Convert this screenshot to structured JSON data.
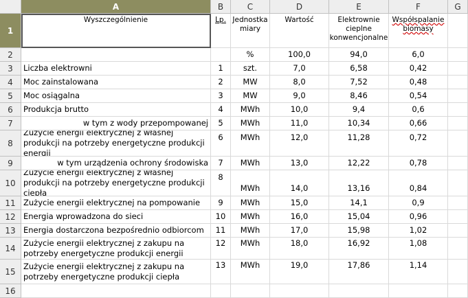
{
  "columns": [
    "A",
    "B",
    "C",
    "D",
    "E",
    "F",
    "G"
  ],
  "header": {
    "row_num": "1",
    "a": "Wyszczególnienie",
    "b": "Lp.",
    "c": "Jednostka miary",
    "d": "Wartość",
    "e": "Elektrownie cieplne konwencjonalne",
    "f": "Współspalanie biomasy"
  },
  "row2": {
    "row_num": "2",
    "c": "%",
    "d": "100,0",
    "e": "94,0",
    "f": "6,0"
  },
  "rows": [
    {
      "row_num": "3",
      "a": "Liczba elektrowni",
      "b": "1",
      "c": "szt.",
      "d": "7,0",
      "e": "6,58",
      "f": "0,42"
    },
    {
      "row_num": "4",
      "a": "Moc zainstalowana",
      "b": "2",
      "c": "MW",
      "d": "8,0",
      "e": "7,52",
      "f": "0,48"
    },
    {
      "row_num": "5",
      "a": "Moc osiągalna",
      "b": "3",
      "c": "MW",
      "d": "9,0",
      "e": "8,46",
      "f": "0,54"
    },
    {
      "row_num": "6",
      "a": "Produkcja brutto",
      "b": "4",
      "c": "MWh",
      "d": "10,0",
      "e": "9,4",
      "f": "0,6"
    },
    {
      "row_num": "7",
      "a": "w tym z wody przepompowanej",
      "b": "5",
      "c": "MWh",
      "d": "11,0",
      "e": "10,34",
      "f": "0,66"
    },
    {
      "row_num": "8",
      "a": "Zużycie energii elektrycznej z własnej produkcji na potrzeby energetyczne produkcji energii",
      "b": "6",
      "c": "MWh",
      "d": "12,0",
      "e": "11,28",
      "f": "0,72"
    },
    {
      "row_num": "9",
      "a": "w tym urządzenia ochrony środowiska",
      "b": "7",
      "c": "MWh",
      "d": "13,0",
      "e": "12,22",
      "f": "0,78"
    },
    {
      "row_num": "10",
      "a": "Zużycie energii elektrycznej z własnej produkcji na potrzeby energetyczne produkcji ciepła",
      "b": "8",
      "c": "MWh",
      "d": "14,0",
      "e": "13,16",
      "f": "0,84"
    },
    {
      "row_num": "11",
      "a": "Zużycie energii elektrycznej na pompowanie",
      "b": "9",
      "c": "MWh",
      "d": "15,0",
      "e": "14,1",
      "f": "0,9"
    },
    {
      "row_num": "12",
      "a": "Energia wprowadzona do sieci",
      "b": "10",
      "c": "MWh",
      "d": "16,0",
      "e": "15,04",
      "f": "0,96"
    },
    {
      "row_num": "13",
      "a": "Energia dostarczona bezpośrednio odbiorcom",
      "b": "11",
      "c": "MWh",
      "d": "17,0",
      "e": "15,98",
      "f": "1,02"
    },
    {
      "row_num": "14",
      "a": "Zużycie energii elektrycznej z zakupu na potrzeby energetyczne produkcji energii",
      "b": "12",
      "c": "MWh",
      "d": "18,0",
      "e": "16,92",
      "f": "1,08"
    },
    {
      "row_num": "15",
      "a": "Zużycie energii elektrycznej z zakupu na potrzeby energetyczne produkcji ciepła",
      "b": "13",
      "c": "MWh",
      "d": "19,0",
      "e": "17,86",
      "f": "1,14"
    }
  ],
  "row16": {
    "row_num": "16"
  }
}
